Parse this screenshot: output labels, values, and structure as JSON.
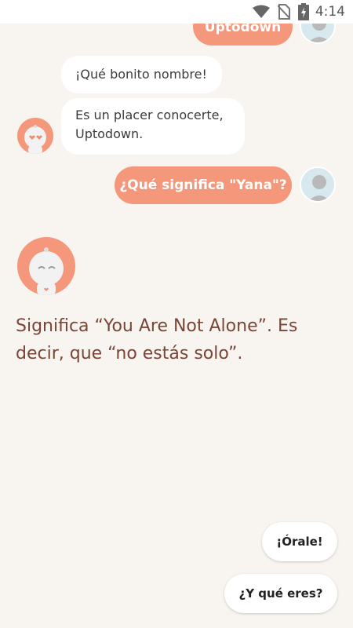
{
  "status_bar": {
    "time": "4:14",
    "icons": [
      "wifi-icon",
      "no-sim-icon",
      "battery-charging-icon"
    ]
  },
  "chat": {
    "user_name_bubble": "Uptodown",
    "bot_message_1": "¡Qué bonito nombre!",
    "bot_message_2": "Es un placer conocerte, Uptodown.",
    "user_question": "¿Qué significa \"Yana\"?",
    "bot_answer": "Significa “You Are Not Alone”. Es decir, que “no estás solo”."
  },
  "quick_replies": {
    "reply_1": "¡Órale!",
    "reply_2": "¿Y qué eres?"
  },
  "colors": {
    "background": "#f8f4ef",
    "accent": "#f4977a",
    "answer_text": "#7a4436"
  }
}
